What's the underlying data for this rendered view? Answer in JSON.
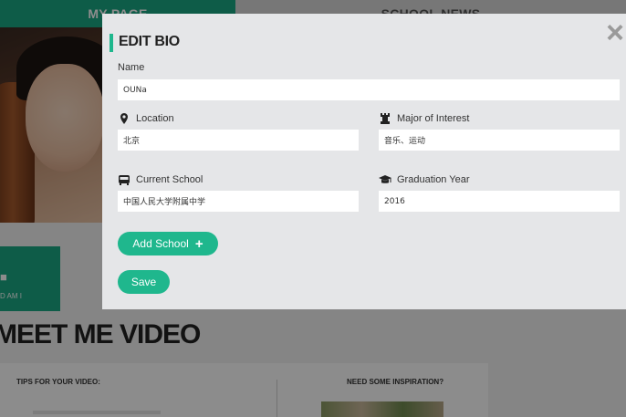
{
  "background": {
    "nav_tabs": [
      "MY PAGE",
      "SCHOOL NEWS"
    ],
    "video_tile_label": "D AM I",
    "section_title": "MEET ME VIDEO",
    "tips_title": "TIPS FOR YOUR VIDEO:",
    "inspiration_title": "NEED SOME INSPIRATION?"
  },
  "modal": {
    "title": "EDIT BIO",
    "close_icon": "×",
    "name": {
      "label": "Name",
      "value": "OUNa"
    },
    "location": {
      "label": "Location",
      "icon": "map-pin-icon",
      "value": "北京"
    },
    "major": {
      "label": "Major of Interest",
      "icon": "castle-rook-icon",
      "value": "音乐、运动"
    },
    "current_school": {
      "label": "Current School",
      "icon": "bus-icon",
      "value": "中国人民大学附属中学"
    },
    "graduation_year": {
      "label": "Graduation Year",
      "icon": "graduation-cap-icon",
      "value": "2016"
    },
    "add_school_label": "Add School",
    "add_school_icon": "+",
    "save_label": "Save"
  },
  "colors": {
    "accent": "#1fb78d",
    "nav_active": "#1aa883",
    "modal_bg": "#e5e6e8"
  }
}
